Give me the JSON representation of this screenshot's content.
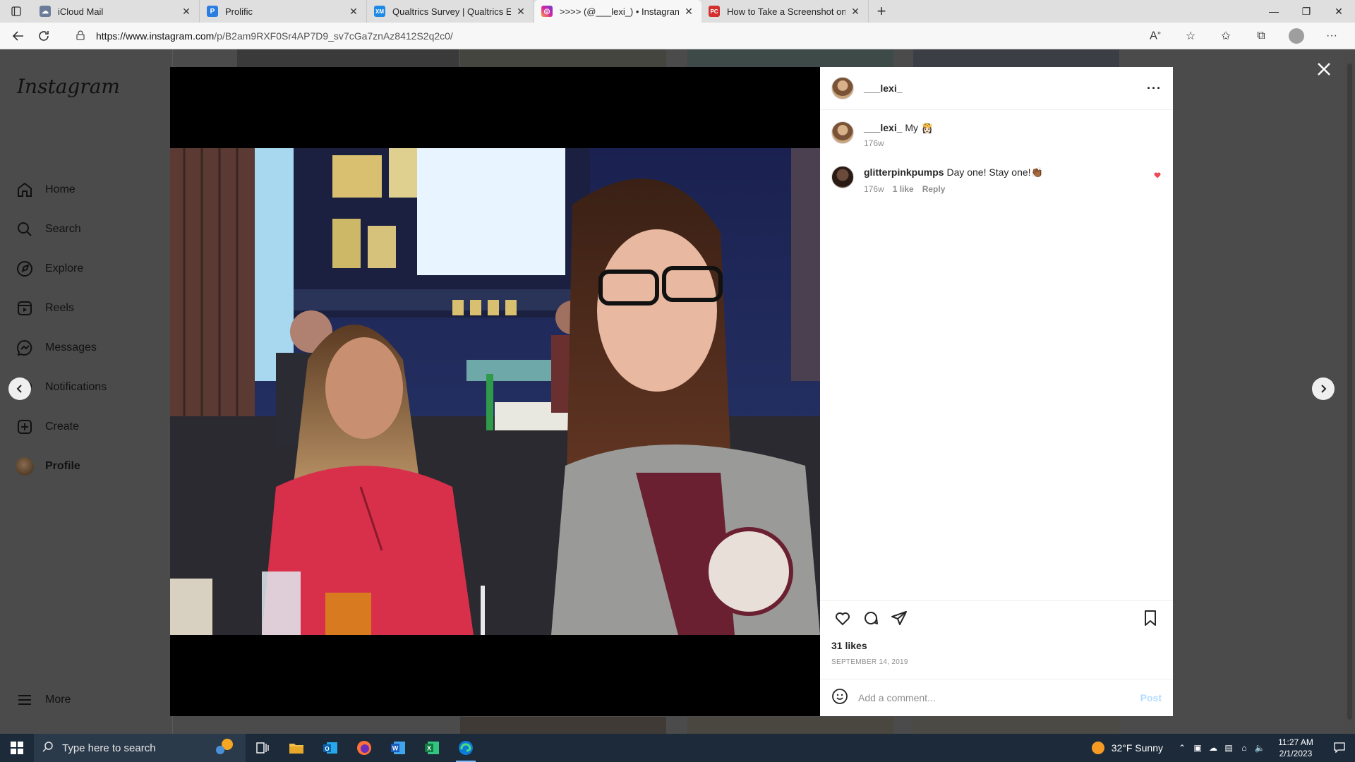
{
  "browser": {
    "tabs": [
      {
        "title": "iCloud Mail",
        "fav_color": "#6a7c99",
        "fav_glyph": ""
      },
      {
        "title": "Prolific",
        "fav_color": "#2a7de1",
        "fav_glyph": "P"
      },
      {
        "title": "Qualtrics Survey | Qualtrics Experi",
        "fav_color": "#1e88e5",
        "fav_glyph": "XM"
      },
      {
        "title": ">>>> (@___lexi_) • Instagram p",
        "fav_color": "#d6249f",
        "fav_glyph": "◎"
      },
      {
        "title": "How to Take a Screenshot on An",
        "fav_color": "#d32f2f",
        "fav_glyph": "PC"
      }
    ],
    "url_host": "https://www.instagram.com",
    "url_path": "/p/B2am9RXF0Sr4AP7D9_sv7cGa7znAz8412S2q2c0/"
  },
  "sidebar": {
    "logo": "Instagram",
    "items": [
      {
        "label": "Home",
        "icon": "home-icon"
      },
      {
        "label": "Search",
        "icon": "search-icon"
      },
      {
        "label": "Explore",
        "icon": "compass-icon"
      },
      {
        "label": "Reels",
        "icon": "reels-icon"
      },
      {
        "label": "Messages",
        "icon": "messenger-icon"
      },
      {
        "label": "Notifications",
        "icon": "heart-icon"
      },
      {
        "label": "Create",
        "icon": "plus-square-icon"
      },
      {
        "label": "Profile",
        "icon": "avatar"
      }
    ],
    "more": "More"
  },
  "post": {
    "username": "___lexi_",
    "caption": {
      "user": "___lexi_",
      "text": "My 👸🏻",
      "time": "176w"
    },
    "comments": [
      {
        "user": "glitterpinkpumps",
        "text": "Day one! Stay one!👏🏾",
        "time": "176w",
        "likes": "1 like",
        "reply": "Reply",
        "liked": true
      }
    ],
    "likes": "31 likes",
    "date": "SEPTEMBER 14, 2019",
    "comment_placeholder": "Add a comment...",
    "post_label": "Post"
  },
  "taskbar": {
    "search_placeholder": "Type here to search",
    "weather": "32°F  Sunny",
    "time": "11:27 AM",
    "date": "2/1/2023"
  }
}
